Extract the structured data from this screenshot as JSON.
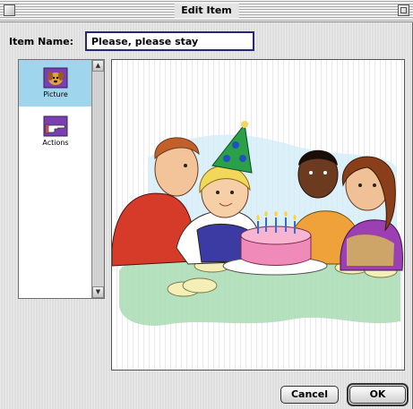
{
  "window": {
    "title": "Edit Item"
  },
  "item_name": {
    "label": "Item Name:",
    "value": "Please, please stay"
  },
  "sidebar": {
    "items": [
      {
        "label": "Picture",
        "icon": "dog-picture-icon",
        "selected": true
      },
      {
        "label": "Actions",
        "icon": "pointing-hand-icon",
        "selected": false
      }
    ]
  },
  "picture": {
    "subject": ""
  },
  "buttons": {
    "cancel": "Cancel",
    "ok": "OK"
  },
  "colors": {
    "selection": "#9fd6ee",
    "field_border": "#26267a"
  }
}
